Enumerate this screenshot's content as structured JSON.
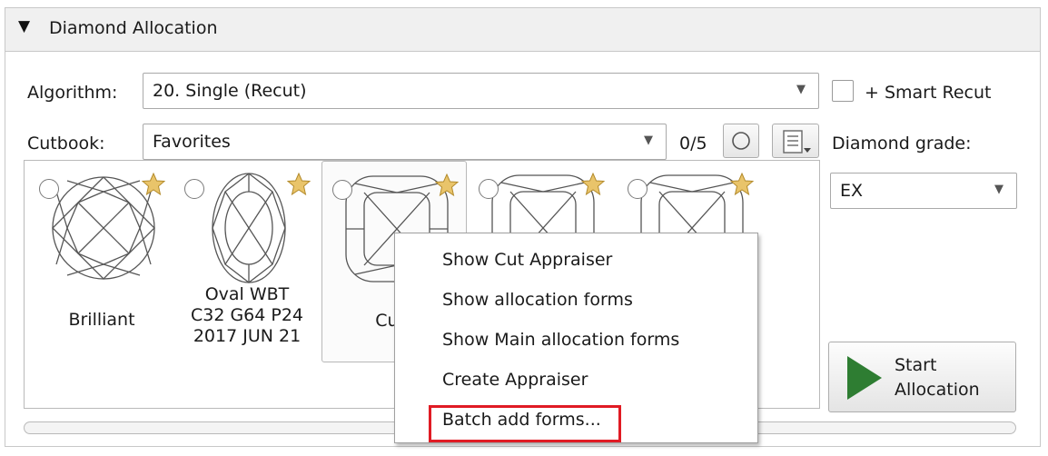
{
  "panel": {
    "title": "Diamond Allocation"
  },
  "algorithm": {
    "label": "Algorithm:",
    "value": "20. Single (Recut)"
  },
  "smart_recut": {
    "label": "+ Smart Recut",
    "checked": false
  },
  "cutbook": {
    "label": "Cutbook:",
    "value": "Favorites",
    "counter": "0/5"
  },
  "diamond_grade": {
    "label": "Diamond grade:",
    "value": "EX"
  },
  "cuts": [
    {
      "name": "Brilliant",
      "shape": "round"
    },
    {
      "name": "Oval WBT\nC32 G64 P24\n2017 JUN 21",
      "shape": "oval"
    },
    {
      "name": "Cu b",
      "shape": "cushion"
    },
    {
      "name": "",
      "shape": "cushion"
    },
    {
      "name": "",
      "shape": "cushion"
    }
  ],
  "start_button": {
    "label": "Start\nAllocation"
  },
  "context_menu": {
    "items": [
      "Show Cut Appraiser",
      "Show allocation forms",
      "Show Main allocation forms",
      "Create Appraiser",
      "Batch add forms..."
    ]
  },
  "colors": {
    "star": "#e9c46a",
    "play": "#2e7d32",
    "highlight": "#e01b24"
  }
}
